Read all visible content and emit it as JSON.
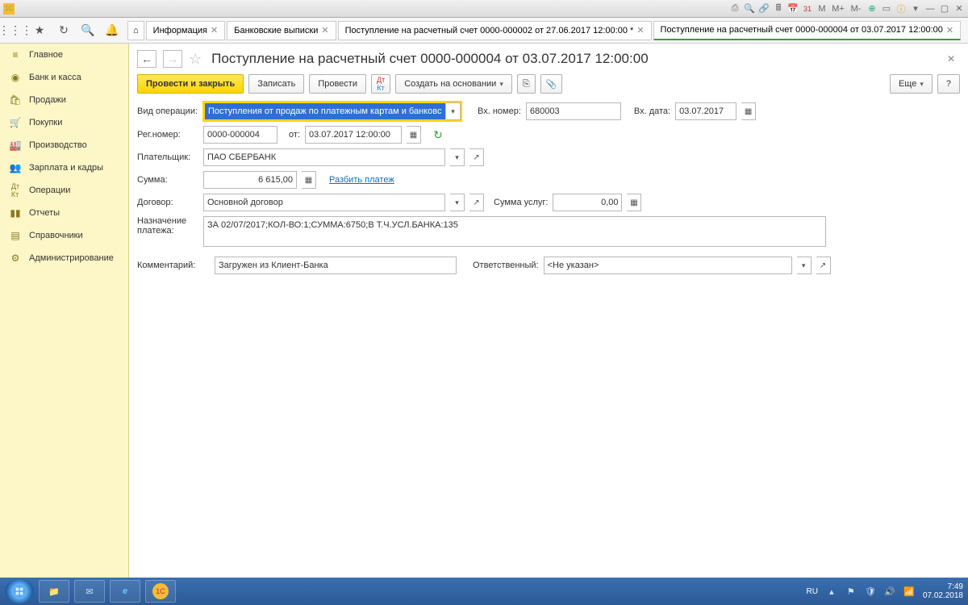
{
  "titlebar": {
    "right_texts": [
      "M",
      "M+",
      "M-"
    ]
  },
  "tabs": [
    {
      "label": "Информация",
      "closable": true
    },
    {
      "label": "Банковские выписки",
      "closable": true
    },
    {
      "label": "Поступление на расчетный счет 0000-000002 от 27.06.2017 12:00:00 *",
      "closable": true
    },
    {
      "label": "Поступление на расчетный счет 0000-000004 от 03.07.2017 12:00:00",
      "closable": true,
      "active": true
    }
  ],
  "sidebar": {
    "items": [
      {
        "label": "Главное",
        "icon": "menu"
      },
      {
        "label": "Банк и касса",
        "icon": "bank"
      },
      {
        "label": "Продажи",
        "icon": "sales"
      },
      {
        "label": "Покупки",
        "icon": "cart"
      },
      {
        "label": "Производство",
        "icon": "industry"
      },
      {
        "label": "Зарплата и кадры",
        "icon": "people"
      },
      {
        "label": "Операции",
        "icon": "ops"
      },
      {
        "label": "Отчеты",
        "icon": "chart"
      },
      {
        "label": "Справочники",
        "icon": "book"
      },
      {
        "label": "Администрирование",
        "icon": "gear"
      }
    ]
  },
  "doc": {
    "title": "Поступление на расчетный счет 0000-000004 от 03.07.2017 12:00:00",
    "actions": {
      "post_close": "Провести и закрыть",
      "save": "Записать",
      "post": "Провести",
      "create_based": "Создать на основании",
      "more": "Еще",
      "help": "?"
    },
    "labels": {
      "op_type": "Вид операции:",
      "ext_num": "Вх. номер:",
      "ext_date": "Вх. дата:",
      "reg_num": "Рег.номер:",
      "from": "от:",
      "payer": "Плательщик:",
      "sum": "Сумма:",
      "split": "Разбить платеж",
      "contract": "Договор:",
      "service_sum": "Сумма услуг:",
      "purpose": "Назначение платежа:",
      "comment": "Комментарий:",
      "responsible": "Ответственный:"
    },
    "values": {
      "op_type": "Поступления от продаж по платежным картам и банковским кре",
      "ext_num": "680003",
      "ext_date": "03.07.2017",
      "reg_num": "0000-000004",
      "reg_date": "03.07.2017 12:00:00",
      "payer": "ПАО СБЕРБАНК",
      "sum": "6 615,00",
      "contract": "Основной договор",
      "service_sum": "0,00",
      "purpose": "ЗА 02/07/2017;КОЛ-ВО:1;СУММА:6750;В Т.Ч.УСЛ.БАНКА:135",
      "comment": "Загружен из Клиент-Банка",
      "responsible": "<Не указан>"
    }
  },
  "taskbar": {
    "lang": "RU",
    "time": "7:49",
    "date": "07.02.2018"
  }
}
